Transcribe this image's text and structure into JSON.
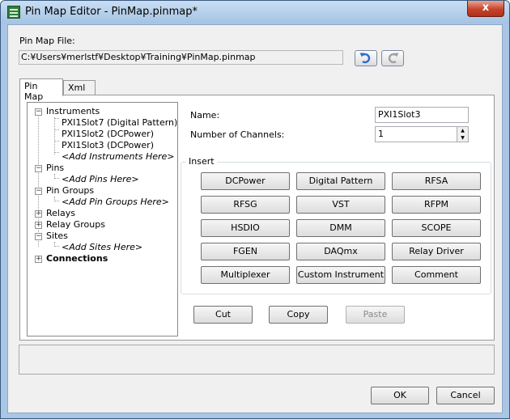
{
  "window": {
    "title": "Pin Map Editor - PinMap.pinmap*",
    "close_glyph": "x",
    "app_icon": "pin-map-editor-icon"
  },
  "file": {
    "label": "Pin Map File:",
    "path": "C:¥Users¥merlstf¥Desktop¥Training¥PinMap.pinmap",
    "undo_icon": "undo-icon",
    "redo_icon": "redo-icon"
  },
  "tabs": [
    {
      "label": "Pin Map",
      "active": true
    },
    {
      "label": "Xml",
      "active": false
    }
  ],
  "tree": {
    "instruments": {
      "label": "Instruments",
      "expander": "−",
      "children": [
        "PXI1Slot7 (Digital Pattern)",
        "PXI1Slot2 (DCPower)",
        "PXI1Slot3 (DCPower)"
      ],
      "add_label": "<Add Instruments Here>"
    },
    "pins": {
      "label": "Pins",
      "expander": "−",
      "add_label": "<Add Pins Here>"
    },
    "pin_groups": {
      "label": "Pin Groups",
      "expander": "−",
      "add_label": "<Add Pin Groups Here>"
    },
    "relays": {
      "label": "Relays",
      "expander": "+"
    },
    "relay_groups": {
      "label": "Relay Groups",
      "expander": "+"
    },
    "sites": {
      "label": "Sites",
      "expander": "−",
      "add_label": "<Add Sites Here>"
    },
    "connections": {
      "label": "Connections",
      "expander": "+"
    }
  },
  "properties": {
    "name_label": "Name:",
    "name_value": "PXI1Slot3",
    "channels_label": "Number of Channels:",
    "channels_value": "1",
    "spin_up": "▲",
    "spin_down": "▼"
  },
  "insert": {
    "label": "Insert",
    "buttons": [
      "DCPower",
      "Digital Pattern",
      "RFSA",
      "RFSG",
      "VST",
      "RFPM",
      "HSDIO",
      "DMM",
      "SCOPE",
      "FGEN",
      "DAQmx",
      "Relay Driver",
      "Multiplexer",
      "Custom Instrument",
      "Comment"
    ]
  },
  "edit_actions": {
    "cut": "Cut",
    "copy": "Copy",
    "paste": "Paste"
  },
  "dialog": {
    "ok": "OK",
    "cancel": "Cancel"
  }
}
